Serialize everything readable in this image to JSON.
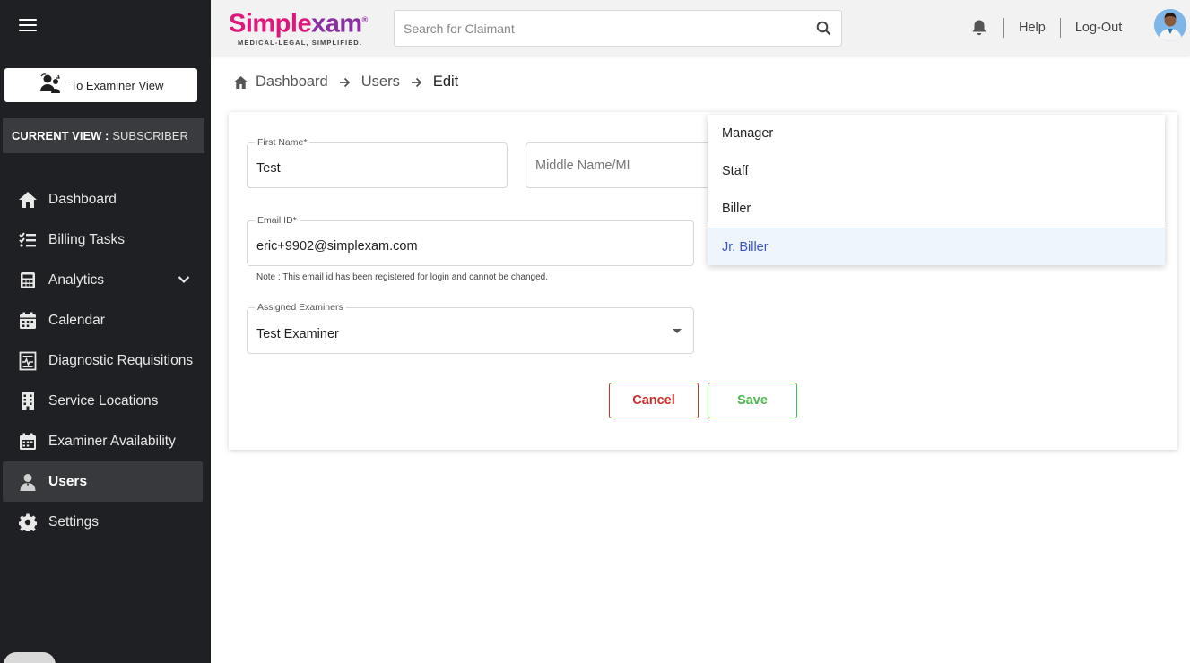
{
  "sidebar": {
    "examiner_button": "To Examiner View",
    "current_view_label": "CURRENT VIEW :",
    "current_view_value": "SUBSCRIBER",
    "items": [
      {
        "label": "Dashboard",
        "icon": "home-icon"
      },
      {
        "label": "Billing Tasks",
        "icon": "tasks-icon"
      },
      {
        "label": "Analytics",
        "icon": "calculator-icon"
      },
      {
        "label": "Calendar",
        "icon": "calendar-icon"
      },
      {
        "label": "Diagnostic Requisitions",
        "icon": "requisition-icon"
      },
      {
        "label": "Service Locations",
        "icon": "building-icon"
      },
      {
        "label": "Examiner Availability",
        "icon": "calendar-check-icon"
      },
      {
        "label": "Users",
        "icon": "user-icon",
        "active": true
      },
      {
        "label": "Settings",
        "icon": "gear-icon"
      }
    ]
  },
  "header": {
    "logo_part1": "Simple",
    "logo_part2": "xam",
    "logo_reg": "®",
    "logo_tagline": "MEDICAL-LEGAL, SIMPLIFIED.",
    "search_placeholder": "Search for Claimant",
    "help": "Help",
    "logout": "Log-Out"
  },
  "breadcrumb": {
    "dashboard": "Dashboard",
    "users": "Users",
    "edit": "Edit"
  },
  "form": {
    "first_name_label": "First Name*",
    "first_name_value": "Test",
    "middle_name_placeholder": "Middle Name/MI",
    "email_label": "Email ID*",
    "email_value": "eric+9902@simplexam.com",
    "email_note": "Note : This email id has been registered for login and cannot be changed.",
    "assigned_label": "Assigned Examiners",
    "assigned_value": "Test Examiner",
    "cancel": "Cancel",
    "save": "Save"
  },
  "dropdown": {
    "options": [
      "Manager",
      "Staff",
      "Biller",
      "Jr. Biller"
    ],
    "selected": "Jr. Biller"
  },
  "colors": {
    "sidebar_bg": "#1f2023",
    "brand_pink": "#e0177b",
    "brand_purple": "#8a2fa0",
    "cancel_red": "#c9302c",
    "save_green": "#4cb74a",
    "selected_option": "#3b52c4"
  }
}
